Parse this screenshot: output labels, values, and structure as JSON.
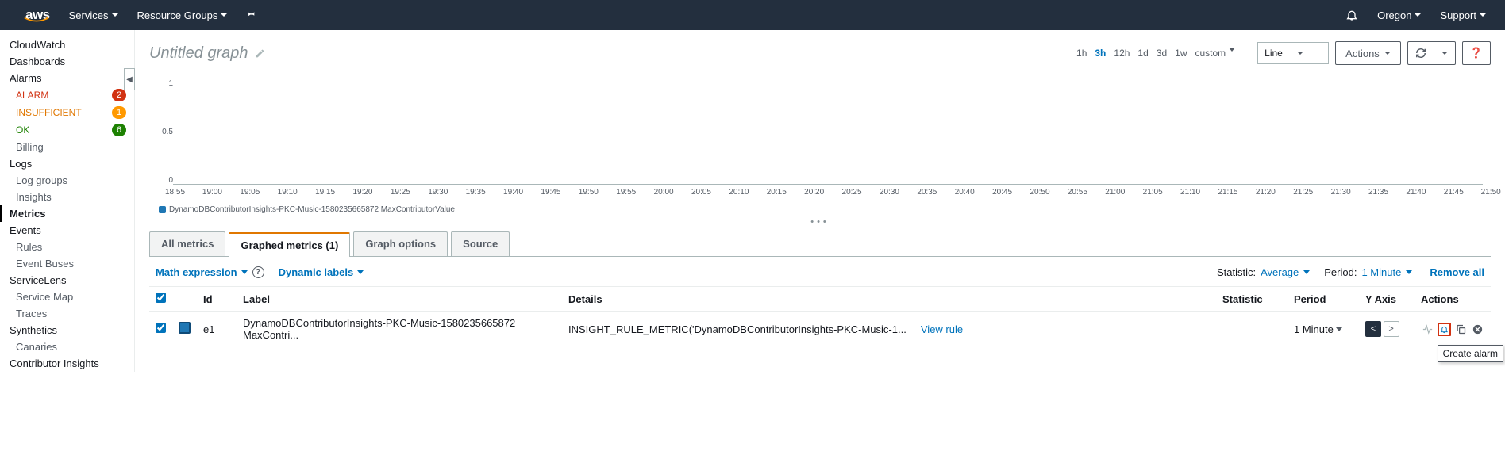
{
  "topnav": {
    "logo": "aws",
    "services": "Services",
    "resource_groups": "Resource Groups",
    "region": "Oregon",
    "support": "Support"
  },
  "sidebar": {
    "cloudwatch": "CloudWatch",
    "dashboards": "Dashboards",
    "alarms": "Alarms",
    "alarm_states": {
      "alarm": "ALARM",
      "insufficient": "INSUFFICIENT",
      "ok": "OK"
    },
    "alarm_counts": {
      "alarm": "2",
      "insufficient": "1",
      "ok": "6"
    },
    "billing": "Billing",
    "logs": "Logs",
    "log_groups": "Log groups",
    "insights": "Insights",
    "metrics": "Metrics",
    "events": "Events",
    "rules": "Rules",
    "event_buses": "Event Buses",
    "servicelens": "ServiceLens",
    "service_map": "Service Map",
    "traces": "Traces",
    "synthetics": "Synthetics",
    "canaries": "Canaries",
    "contributor_insights": "Contributor Insights"
  },
  "graph": {
    "title": "Untitled graph",
    "time_options": [
      "1h",
      "3h",
      "12h",
      "1d",
      "3d",
      "1w",
      "custom"
    ],
    "time_active": 1,
    "line_type": "Line",
    "actions_label": "Actions"
  },
  "chart_data": {
    "type": "line",
    "title": "",
    "xlabel": "",
    "ylabel": "",
    "ylim": [
      0,
      1
    ],
    "y_ticks": [
      "1",
      "0.5",
      "0"
    ],
    "x_ticks": [
      "18:55",
      "19:00",
      "19:05",
      "19:10",
      "19:15",
      "19:20",
      "19:25",
      "19:30",
      "19:35",
      "19:40",
      "19:45",
      "19:50",
      "19:55",
      "20:00",
      "20:05",
      "20:10",
      "20:15",
      "20:20",
      "20:25",
      "20:30",
      "20:35",
      "20:40",
      "20:45",
      "20:50",
      "20:55",
      "21:00",
      "21:05",
      "21:10",
      "21:15",
      "21:20",
      "21:25",
      "21:30",
      "21:35",
      "21:40",
      "21:45",
      "21:50"
    ],
    "series": [
      {
        "name": "DynamoDBContributorInsights-PKC-Music-1580235665872 MaxContributorValue",
        "color": "#1f77b4",
        "values": []
      }
    ]
  },
  "tabs": {
    "all": "All metrics",
    "graphed": "Graphed metrics (1)",
    "options": "Graph options",
    "source": "Source"
  },
  "toolbar": {
    "math": "Math expression",
    "dynamic": "Dynamic labels",
    "statistic_lbl": "Statistic:",
    "statistic_val": "Average",
    "period_lbl": "Period:",
    "period_val": "1 Minute",
    "remove_all": "Remove all"
  },
  "table": {
    "headers": {
      "id": "Id",
      "label": "Label",
      "details": "Details",
      "statistic": "Statistic",
      "period": "Period",
      "yaxis": "Y Axis",
      "actions": "Actions"
    },
    "rows": [
      {
        "id": "e1",
        "label": "DynamoDBContributorInsights-PKC-Music-1580235665872 MaxContri...",
        "details": "INSIGHT_RULE_METRIC('DynamoDBContributorInsights-PKC-Music-1...",
        "view_rule": "View rule",
        "statistic": "",
        "period": "1 Minute"
      }
    ],
    "tooltip": "Create alarm"
  }
}
